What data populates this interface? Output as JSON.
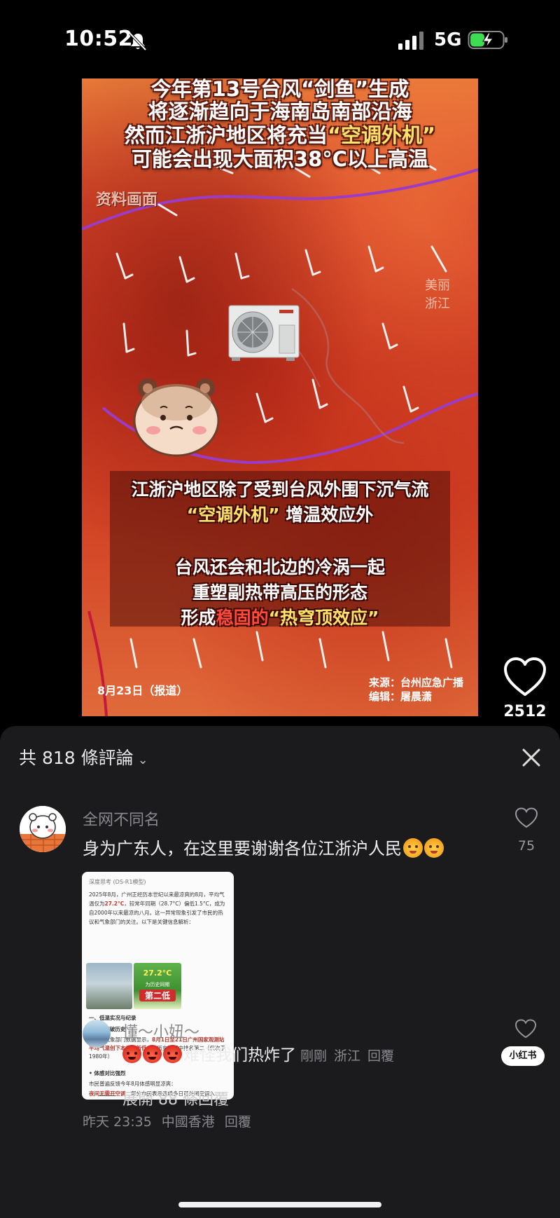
{
  "status": {
    "time": "10:52",
    "network": "5G",
    "icons": [
      "bell-muted-icon",
      "signal-icon",
      "battery-charging-icon"
    ]
  },
  "video": {
    "title_lines": [
      "今年第13号台风“剑鱼”生成",
      "将逐渐趋向于海南岛南部沿海",
      "然而江浙沪地区将充当",
      "“空调外机”",
      "可能会出现大面积38°C以上高温"
    ],
    "source_tag": "资料画面",
    "watermark": "美丽浙江",
    "caption_lines": [
      "江浙沪地区除了受到台风外围下沉气流",
      "“空调外机”",
      "增温效应外",
      "台风还会和北边的冷涡一起",
      "重塑副热带高压的形态",
      "形成",
      "稳固的",
      "“热穹顶效应”"
    ],
    "date": "8月23日（报道）",
    "credit_source": "来源：台州应急广播",
    "credit_editor": "编辑：屠晨潇"
  },
  "like": {
    "count": "2512"
  },
  "comments_panel": {
    "title": "共 818 條評論",
    "comment": {
      "username": "全网不同名",
      "text": "身为广东人，在这里要谢谢各位江浙沪人民",
      "likes": "75",
      "time": "昨天 23:35",
      "location": "中國香港",
      "reply_label": "回覆",
      "attachment": {
        "header": "深度思考 (DS-R1模型)",
        "paragraph_a": "2025年8月，广州正经历本世纪以来最凉爽的8月，平均气温仅为",
        "paragraph_b": "27.2°C",
        "paragraph_c": "，较常年同期（28.7°C）偏低1.5°C，成为自2000年以来最凉的八月。这一异常现象引发了市民的热议和气象部门的关注。以下是关键信息解析：",
        "img_temp": "27.2°C",
        "img_sub": "为历史同期",
        "img_rank": "第二低",
        "sec1": "一、低温实况与纪录",
        "sec1a": "• 数据突破历史",
        "sec1b": "广州市气象部门数据显示，",
        "sec1c": "8月1日至21日广州国家观测站平均气温创下本世纪新低",
        "sec1d": "，在历史同期中排名第二（仅次于1980年）",
        "sec2": "• 体感对比强烈",
        "sec2a": "市民普遍反馈今年8月体感明显凉爽：",
        "sec2b": "夜间无需开空调",
        "sec2c": "：部分市民表示连续多日可关闭空调入"
      }
    },
    "reply": {
      "username": "懂～小妞～",
      "text": "难怪我们热炸了",
      "time": "剛剛",
      "location": "浙江",
      "reply_label": "回覆"
    },
    "expand_label": "展開 88 條回覆",
    "badge": "小红书"
  }
}
